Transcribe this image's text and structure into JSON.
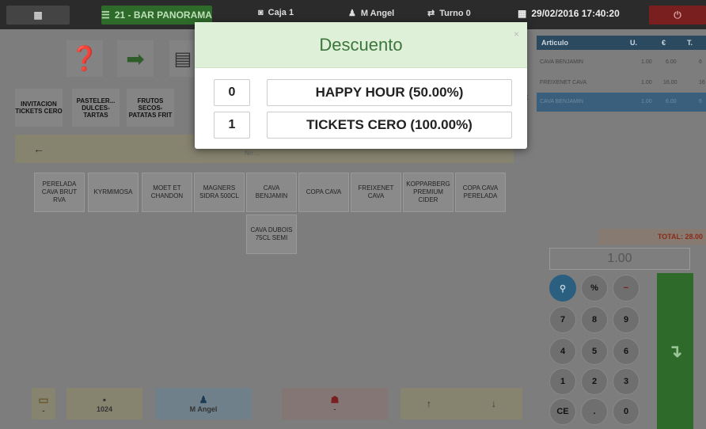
{
  "topbar": {
    "grid_icon": "grid-icon",
    "table_label": "21 - BAR PANORAMA",
    "caja": "Caja 1",
    "user": "M Angel",
    "turno": "Turno 0",
    "datetime": "29/02/2016 17:40:20",
    "power_icon": "power-icon"
  },
  "families": [
    {
      "label": "INVITACION TICKETS CERO"
    },
    {
      "label": "PASTELER... DULCES- TARTAS"
    },
    {
      "label": "FRUTOS SECOS- PATATAS FRIT"
    }
  ],
  "products": [
    "PERELADA CAVA BRUT RVA",
    "KYRMIMOSA",
    "MOET ET CHANDON",
    "MAGNERS SIDRA 500CL",
    "CAVA BENJAMIN",
    "COPA CAVA",
    "FREIXENET CAVA",
    "KOPPARBERG PREMIUM CIDER",
    "COPA CAVA PERELADA",
    "CAVA DUBOIS 75CL SEMI"
  ],
  "search_bar_text": "No ...",
  "ticket": {
    "headers": [
      "Articulo",
      "U.",
      "€",
      "T."
    ],
    "rows": [
      {
        "name": "CAVA BENJAMIN",
        "u": "1.00",
        "price": "6.00",
        "total": "6"
      },
      {
        "name": "FREIXENET CAVA",
        "u": "1.00",
        "price": "16.00",
        "total": "16"
      },
      {
        "name": "CAVA BENJAMIN",
        "u": "1.00",
        "price": "6.00",
        "total": "6"
      }
    ],
    "total_label": "TOTAL: 28.00"
  },
  "keypad": {
    "display": "1.00",
    "keys": [
      "%",
      "−",
      "7",
      "8",
      "9",
      "4",
      "5",
      "6",
      "1",
      "2",
      "3",
      "CE",
      ".",
      "0"
    ]
  },
  "modal": {
    "title": "Descuento",
    "close": "×",
    "discounts": [
      {
        "num": "0",
        "name": "HAPPY HOUR (50.00%)"
      },
      {
        "num": "1",
        "name": "TICKETS CERO (100.00%)"
      }
    ]
  },
  "bottom": {
    "b1": "-",
    "b2": "1024",
    "b3": "M Angel",
    "b4": "-",
    "up": "↑",
    "down": "↓"
  },
  "colors": {
    "green": "#3f8a3a",
    "red": "#a82a2a",
    "blue": "#2d6f95"
  }
}
